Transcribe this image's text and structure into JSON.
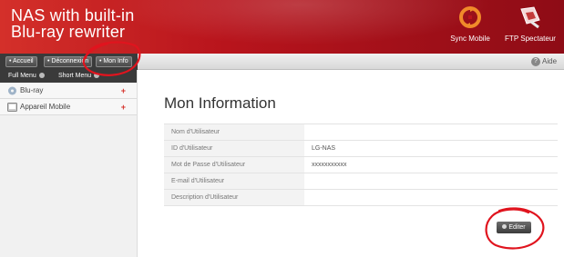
{
  "header": {
    "title_line1": "NAS with built-in",
    "title_line2": "Blu-ray rewriter",
    "sync_label": "Sync Mobile",
    "ftp_label": "FTP Spectateur"
  },
  "toolbar": {
    "nav": [
      "• Accueil",
      "• Déconnexion",
      "• Mon Info"
    ],
    "help_label": "Aide"
  },
  "sidebar": {
    "tabs": [
      "Full Menu",
      "Short Menu"
    ],
    "items": [
      {
        "label": "Blu-ray",
        "icon": "disc-icon"
      },
      {
        "label": "Appareil Mobile",
        "icon": "mobile-device-icon"
      }
    ],
    "expand_symbol": "+"
  },
  "main": {
    "title": "Mon Information",
    "rows": [
      {
        "label": "Nom d'Utilisateur",
        "value": ""
      },
      {
        "label": "ID d'Utilisateur",
        "value": "LG-NAS"
      },
      {
        "label": "Mot de Passe d'Utilisateur",
        "value": "xxxxxxxxxxx"
      },
      {
        "label": "E-mail d'Utilisateur",
        "value": ""
      },
      {
        "label": "Description d'Utilisateur",
        "value": ""
      }
    ],
    "edit_label": "Editer"
  },
  "colors": {
    "brand": "#b8141c",
    "annotation": "#e0141e"
  }
}
